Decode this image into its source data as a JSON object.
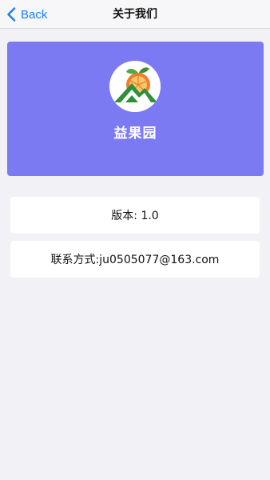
{
  "nav": {
    "back_label": "Back",
    "title": "关于我们"
  },
  "hero": {
    "logo_icon": "mountain-fruit-logo-icon",
    "app_name": "益果园",
    "background_color": "#7b7af3"
  },
  "info": {
    "version_text": "版本: 1.0",
    "contact_text": "联系方式:ju0505077@163.com"
  },
  "colors": {
    "accent": "#1f7cf4",
    "page_bg": "#f2f1f6"
  }
}
